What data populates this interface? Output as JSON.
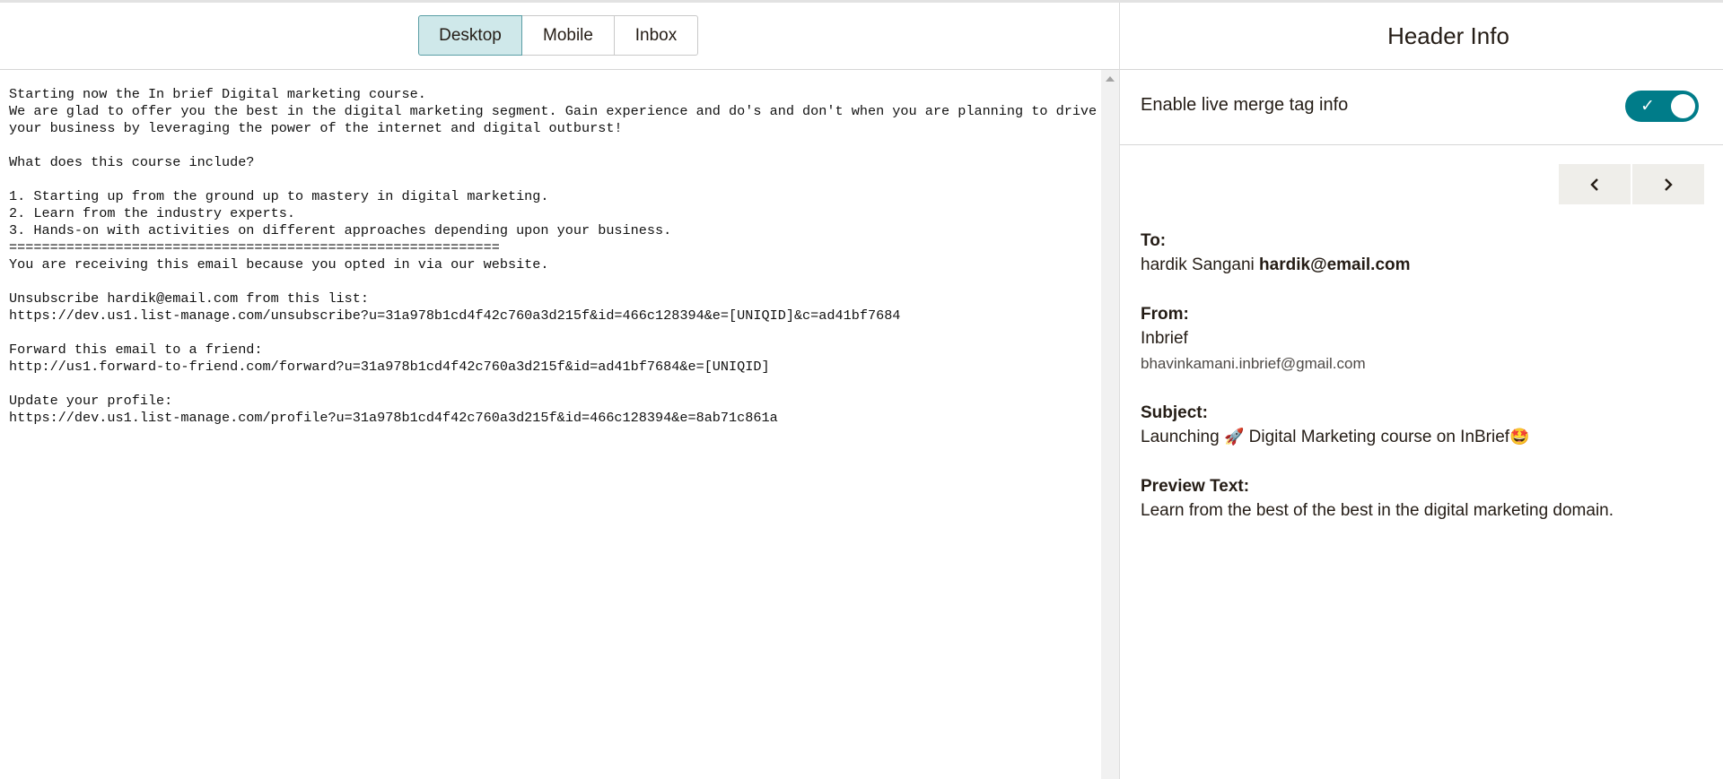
{
  "view_tabs": {
    "desktop": "Desktop",
    "mobile": "Mobile",
    "inbox": "Inbox",
    "active": "Desktop"
  },
  "plain_text_email": "Starting now the In brief Digital marketing course.\nWe are glad to offer you the best in the digital marketing segment. Gain experience and do's and don't when you are planning to drive\nyour business by leveraging the power of the internet and digital outburst!\n\nWhat does this course include?\n\n1. Starting up from the ground up to mastery in digital marketing.\n2. Learn from the industry experts.\n3. Hands-on with activities on different approaches depending upon your business.\n============================================================\nYou are receiving this email because you opted in via our website.\n\nUnsubscribe hardik@email.com from this list:\nhttps://dev.us1.list-manage.com/unsubscribe?u=31a978b1cd4f42c760a3d215f&id=466c128394&e=[UNIQID]&c=ad41bf7684\n\nForward this email to a friend:\nhttp://us1.forward-to-friend.com/forward?u=31a978b1cd4f42c760a3d215f&id=ad41bf7684&e=[UNIQID]\n\nUpdate your profile:\nhttps://dev.us1.list-manage.com/profile?u=31a978b1cd4f42c760a3d215f&id=466c128394&e=8ab71c861a",
  "header_info": {
    "title": "Header Info",
    "merge_tag_label": "Enable live merge tag info",
    "merge_tag_enabled": true,
    "to_label": "To:",
    "to_name": "hardik Sangani",
    "to_email": "hardik@email.com",
    "from_label": "From:",
    "from_name": "Inbrief",
    "from_email": "bhavinkamani.inbrief@gmail.com",
    "subject_label": "Subject:",
    "subject_part1": "Launching ",
    "subject_emoji1": "🚀",
    "subject_part2": " Digital Marketing  course on InBrief",
    "subject_emoji2": "🤩",
    "preview_label": "Preview Text:",
    "preview_text": "Learn from the best of the best in the digital marketing domain."
  },
  "colors": {
    "accent": "#007c89",
    "active_tab_bg": "#cfe8ea"
  },
  "icons": {
    "prev": "chevron-left-icon",
    "next": "chevron-right-icon",
    "toggle_check": "checkmark-icon"
  }
}
